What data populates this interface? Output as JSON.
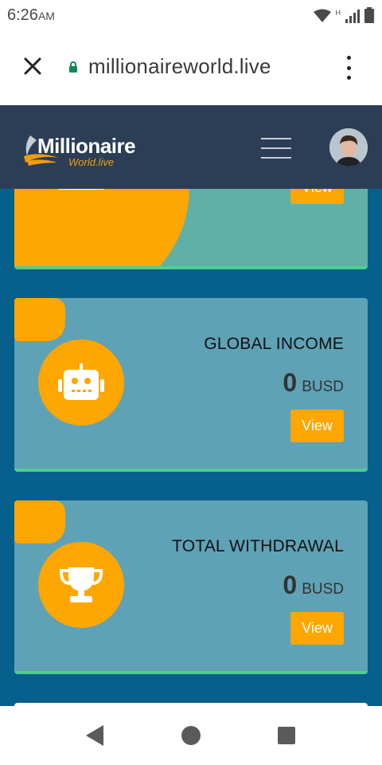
{
  "status_bar": {
    "time": "6:26",
    "ampm": "AM",
    "network_label": "H"
  },
  "browser": {
    "url": "millionaireworld.live",
    "close_icon": "close-icon",
    "lock_icon": "lock-icon",
    "menu_icon": "more-vert-icon"
  },
  "site_header": {
    "logo_title": "Millionaire",
    "logo_sub": "World.live",
    "menu_icon": "hamburger-icon",
    "avatar_icon": "avatar"
  },
  "cards": [
    {
      "icon": "trophy-icon",
      "view_label": "View"
    },
    {
      "title": "GLOBAL INCOME",
      "amount": "0",
      "unit": "BUSD",
      "icon": "robot-icon",
      "view_label": "View"
    },
    {
      "title": "TOTAL WITHDRAWAL",
      "amount": "0",
      "unit": "BUSD",
      "icon": "trophy-icon",
      "view_label": "View"
    }
  ],
  "colors": {
    "page_bg": "#075f8c",
    "header_bg": "#2c3e55",
    "card_bg": "#5fa2b6",
    "accent_orange": "#fea601",
    "card_bottom_border": "#4cd08f"
  },
  "nav_bar": {
    "back_icon": "back-icon",
    "home_icon": "home-icon",
    "recent_icon": "recent-apps-icon"
  }
}
